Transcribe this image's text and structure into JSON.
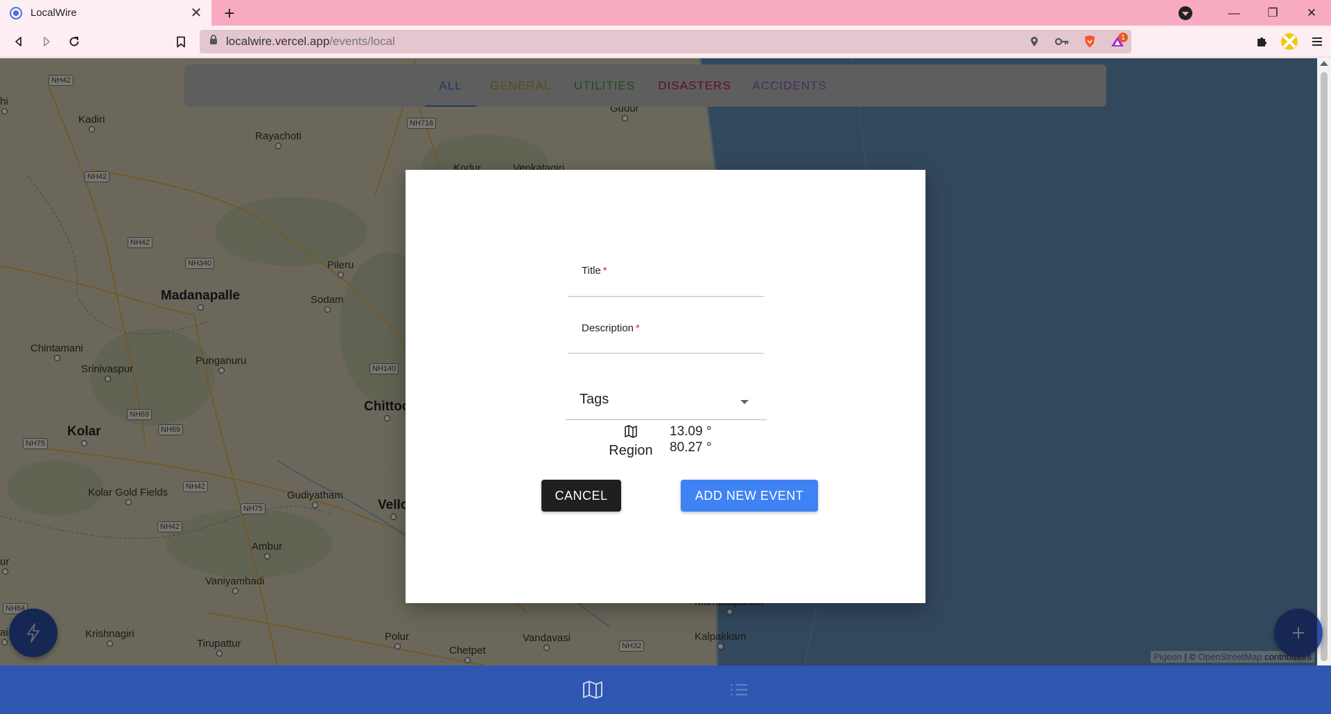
{
  "browser": {
    "tab_title": "LocalWire",
    "url_host": "localwire.vercel.app",
    "url_path": "/events/local",
    "notification_count": "1"
  },
  "categories": [
    {
      "label": "ALL",
      "color": "#3f6ed3",
      "active": true
    },
    {
      "label": "GENERAL",
      "color": "#b39a2c",
      "active": false
    },
    {
      "label": "UTILITIES",
      "color": "#3d9a3d",
      "active": false
    },
    {
      "label": "DISASTERS",
      "color": "#c2185b",
      "active": false
    },
    {
      "label": "ACCIDENTS",
      "color": "#8a5cb8",
      "active": false
    }
  ],
  "map": {
    "places": [
      "Kadiri",
      "Rayachoti",
      "Madanapalle",
      "Pileru",
      "Sodam",
      "Chintamani",
      "Srinivaspur",
      "Punganuru",
      "Chittoo",
      "Kolar",
      "Kolar Gold Fields",
      "Gudiyatham",
      "Vello",
      "Ambur",
      "Vaniyambadi",
      "Krishnagiri",
      "Tirupattur",
      "Polur",
      "Chetpet",
      "Vandavasi",
      "Kalpakkam",
      "Kodur",
      "Venkatagiri",
      "Gudur",
      "hi",
      "ai",
      "ur",
      "Mamallapuram"
    ],
    "highways": [
      "NH42",
      "NH42",
      "NH42",
      "NH340",
      "NH716",
      "NH140",
      "NH69",
      "NH69",
      "NH75",
      "NH42",
      "NH75",
      "NH42",
      "NH32",
      "NH84"
    ],
    "attribution_pigeon": "Pigeon",
    "attribution_sep": " | © ",
    "attribution_osm": "OpenStreetMap",
    "attribution_suffix": " contributors"
  },
  "dialog": {
    "title_label": "Title",
    "description_label": "Description",
    "required_mark": "*",
    "tags_label": "Tags",
    "region_label": "Region",
    "latitude": "13.09 °",
    "longitude": "80.27 °",
    "cancel_label": "CANCEL",
    "add_label": "ADD NEW EVENT"
  },
  "colors": {
    "primary": "#2f56b0",
    "add_button": "#3f82f3",
    "tabbar": "#f8abc0"
  },
  "icons": {
    "fab_left": "lightning-icon",
    "fab_right": "plus-icon",
    "nav_map": "map-icon",
    "nav_list": "list-icon"
  }
}
